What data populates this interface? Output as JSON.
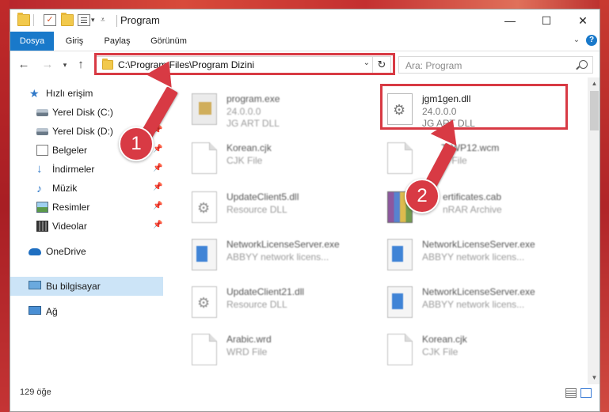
{
  "window": {
    "title": "Program",
    "controls": {
      "minimize": "—",
      "maximize": "☐",
      "close": "✕"
    }
  },
  "ribbon": {
    "tabs": [
      "Dosya",
      "Giriş",
      "Paylaş",
      "Görünüm"
    ],
    "help": "?"
  },
  "address": {
    "path": "C:\\Program Files\\Program Dizini",
    "refresh": "↻"
  },
  "search": {
    "placeholder": "Ara: Program"
  },
  "nav": {
    "quick_access": "Hızlı erişim",
    "items": [
      "Yerel Disk (C:)",
      "Yerel Disk (D:)",
      "Belgeler",
      "İndirmeler",
      "Müzik",
      "Resimler",
      "Videolar"
    ],
    "onedrive": "OneDrive",
    "this_pc": "Bu bilgisayar",
    "network": "Ağ"
  },
  "files": [
    {
      "name": "program.exe",
      "line2": "24.0.0.0",
      "line3": "JG ART DLL",
      "icon": "exe-icon"
    },
    {
      "name": "jgm1gen.dll",
      "line2": "24.0.0.0",
      "line3": "JG ART DLL",
      "icon": "gear-file-icon"
    },
    {
      "name": "Korean.cjk",
      "line2": "CJK File",
      "line3": "",
      "icon": "document-icon"
    },
    {
      "name": "ToWP12.wcm",
      "line2": "M File",
      "line3": "",
      "icon": "document-icon"
    },
    {
      "name": "UpdateClient5.dll",
      "line2": "Resource DLL",
      "line3": "",
      "icon": "gear-file-icon"
    },
    {
      "name": "ertificates.cab",
      "line2": "nRAR Archive",
      "line3": "",
      "icon": "archive-icon"
    },
    {
      "name": "NetworkLicenseServer.exe",
      "line2": "ABBYY network licens...",
      "line3": "",
      "icon": "app-icon"
    },
    {
      "name": "NetworkLicenseServer.exe",
      "line2": "ABBYY network licens...",
      "line3": "",
      "icon": "app-icon"
    },
    {
      "name": "UpdateClient21.dll",
      "line2": "Resource DLL",
      "line3": "",
      "icon": "gear-file-icon"
    },
    {
      "name": "NetworkLicenseServer.exe",
      "line2": "ABBYY network licens...",
      "line3": "",
      "icon": "app-icon"
    },
    {
      "name": "Arabic.wrd",
      "line2": "WRD File",
      "line3": "",
      "icon": "document-icon"
    },
    {
      "name": "Korean.cjk",
      "line2": "CJK File",
      "line3": "",
      "icon": "document-icon"
    }
  ],
  "status": {
    "count": "129 öğe"
  },
  "callouts": [
    "1",
    "2"
  ],
  "colors": {
    "accent": "#1979ca",
    "highlight": "#d83a44",
    "selection": "#cce4f7"
  }
}
